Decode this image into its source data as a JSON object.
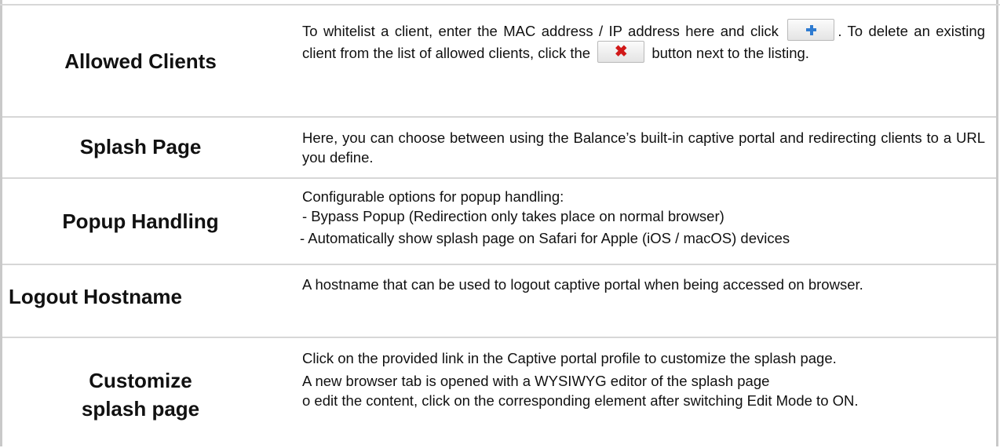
{
  "rows": [
    {
      "label": "Allowed Clients",
      "desc_part1": "To whitelist a client, enter the MAC address / IP address here and click",
      "desc_part2": ". To delete an existing client from the list of allowed clients, click the",
      "desc_part3": "button next to the listing.",
      "add_icon": "plus-icon",
      "delete_icon": "close-icon"
    },
    {
      "label": "Splash Page",
      "desc": "Here, you can choose between using the Balance’s built-in captive portal and redirecting clients to a URL you define."
    },
    {
      "label": "Popup Handling",
      "lines": [
        "Configurable options for popup handling:",
        "- Bypass Popup (Redirection only takes place on normal browser)",
        " -  Automatically show splash page on Safari for Apple (iOS / macOS) devices"
      ]
    },
    {
      "label": "Logout Hostname",
      "desc": "A hostname that can be used to logout captive portal when being accessed on browser."
    },
    {
      "label_line1": "Customize",
      "label_line2": "splash page",
      "lines": [
        "Click on the provided link in the Captive portal profile to customize the splash page.",
        "A new browser tab is opened with a WYSIWYG editor of the splash page",
        "o edit the content, click on the corresponding element after switching Edit Mode to ON."
      ]
    }
  ],
  "colors": {
    "border": "#d7d7d7",
    "plus": "#2e7bd1",
    "cross": "#d11818"
  }
}
